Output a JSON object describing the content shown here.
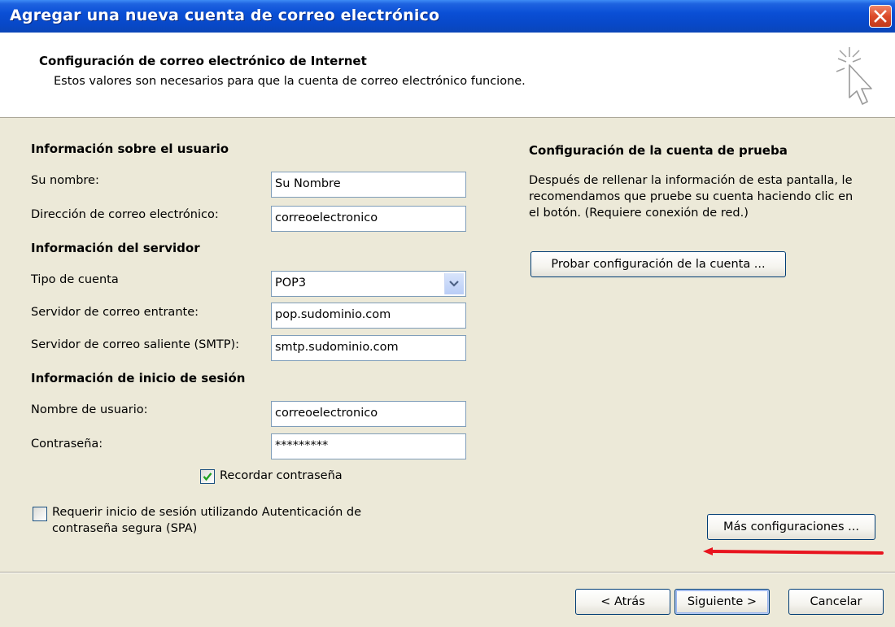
{
  "window": {
    "title": "Agregar una nueva cuenta de correo electrónico"
  },
  "header": {
    "title": "Configuración de correo electrónico de Internet",
    "subtitle": "Estos valores son necesarios para que la cuenta de correo electrónico funcione."
  },
  "user_info": {
    "heading": "Información sobre el usuario",
    "name_label": "Su nombre:",
    "name_value": "Su Nombre",
    "email_label": "Dirección de correo electrónico:",
    "email_value": "correoelectronico"
  },
  "server_info": {
    "heading": "Información del servidor",
    "account_type_label": "Tipo de cuenta",
    "account_type_value": "POP3",
    "incoming_label": "Servidor de correo entrante:",
    "incoming_value": "pop.sudominio.com",
    "outgoing_label": "Servidor de correo saliente (SMTP):",
    "outgoing_value": "smtp.sudominio.com"
  },
  "login_info": {
    "heading": "Información de inicio de sesión",
    "username_label": "Nombre de usuario:",
    "username_value": "correoelectronico",
    "password_label": "Contraseña:",
    "password_value": "*********",
    "remember_label": "Recordar contraseña",
    "remember_checked": true,
    "spa_label_line1": "Requerir inicio de sesión utilizando Autenticación de",
    "spa_label_line2": "contraseña segura (SPA)",
    "spa_checked": false
  },
  "test_settings": {
    "heading": "Configuración de la cuenta de prueba",
    "description_line1": "Después de rellenar la información de esta pantalla, le",
    "description_line2": "recomendamos que pruebe su cuenta haciendo clic en",
    "description_line3": "el botón. (Requiere conexión de red.)",
    "test_button": "Probar configuración de la cuenta ...",
    "more_settings_button": "Más configuraciones ..."
  },
  "footer": {
    "back_button": "< Atrás",
    "next_button": "Siguiente >",
    "cancel_button": "Cancelar"
  },
  "colors": {
    "title_bar": "#0a4fd6",
    "dialog_bg": "#ece9d8",
    "annotation_arrow": "#e8141e"
  },
  "icons": {
    "close": "close-icon",
    "wizard": "cursor-sparkle-icon",
    "dropdown": "chevron-down-icon",
    "check": "checkmark-icon"
  }
}
